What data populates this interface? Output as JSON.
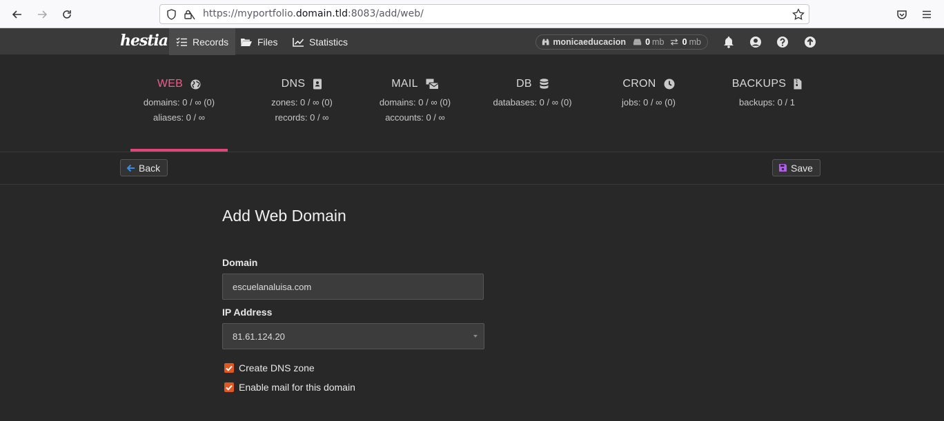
{
  "browser": {
    "url_prefix": "https://myportfolio.",
    "url_domain": "domain.tld",
    "url_suffix": ":8083/add/web/"
  },
  "topnav": {
    "logo": "hestia",
    "items": [
      {
        "label": "Records",
        "icon": "list-check-icon",
        "active": true
      },
      {
        "label": "Files",
        "icon": "folder-open-icon",
        "active": false
      },
      {
        "label": "Statistics",
        "icon": "chart-line-icon",
        "active": false
      }
    ],
    "user": "monicaeducacion",
    "disk_value": "0",
    "disk_unit": "mb",
    "bandwidth_value": "0",
    "bandwidth_unit": "mb"
  },
  "stats": [
    {
      "title": "WEB",
      "icon": "globe-icon",
      "lines": [
        "domains: 0 / ∞ (0)",
        "aliases: 0 / ∞"
      ],
      "active": true
    },
    {
      "title": "DNS",
      "icon": "address-book-icon",
      "lines": [
        "zones: 0 / ∞ (0)",
        "records: 0 / ∞"
      ],
      "active": false
    },
    {
      "title": "MAIL",
      "icon": "mail-bulk-icon",
      "lines": [
        "domains: 0 / ∞ (0)",
        "accounts: 0 / ∞"
      ],
      "active": false
    },
    {
      "title": "DB",
      "icon": "database-icon",
      "lines": [
        "databases: 0 / ∞ (0)"
      ],
      "active": false
    },
    {
      "title": "CRON",
      "icon": "clock-icon",
      "lines": [
        "jobs: 0 / ∞ (0)"
      ],
      "active": false
    },
    {
      "title": "BACKUPS",
      "icon": "file-archive-icon",
      "lines": [
        "backups: 0 / 1"
      ],
      "active": false
    }
  ],
  "toolbar": {
    "back_label": "Back",
    "save_label": "Save"
  },
  "form": {
    "title": "Add Web Domain",
    "domain_label": "Domain",
    "domain_value": "escuelanaluisa.com",
    "ip_label": "IP Address",
    "ip_value": "81.61.124.20",
    "create_dns_label": "Create DNS zone",
    "create_dns_checked": true,
    "enable_mail_label": "Enable mail for this domain",
    "enable_mail_checked": true
  },
  "colors": {
    "accent_pink": "#e2457a",
    "checkbox_orange": "#e0571f",
    "save_icon_purple": "#b45cf0",
    "back_icon_blue": "#3a8ee6"
  }
}
